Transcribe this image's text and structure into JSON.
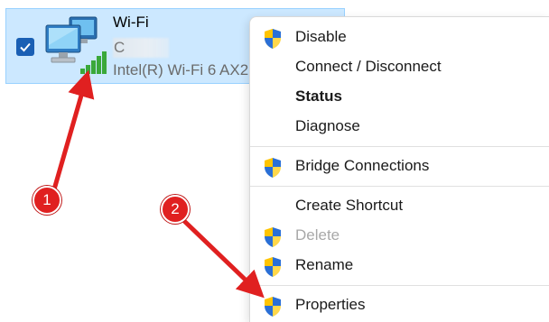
{
  "adapter": {
    "name": "Wi-Fi",
    "network": "C",
    "device": "Intel(R) Wi-Fi 6 AX2",
    "checked": true
  },
  "menu": {
    "items": [
      {
        "label": "Disable",
        "shield": true
      },
      {
        "label": "Connect / Disconnect",
        "shield": false
      },
      {
        "label": "Status",
        "shield": false,
        "bold": true
      },
      {
        "label": "Diagnose",
        "shield": false
      },
      {
        "label": "Bridge Connections",
        "shield": true
      },
      {
        "label": "Create Shortcut",
        "shield": false
      },
      {
        "label": "Delete",
        "shield": true,
        "disabled": true
      },
      {
        "label": "Rename",
        "shield": true
      },
      {
        "label": "Properties",
        "shield": true
      }
    ]
  },
  "annotations": {
    "badge1": "1",
    "badge2": "2",
    "color": "#e02020"
  },
  "colors": {
    "selection_bg": "#cce8ff",
    "selection_border": "#99d1ff",
    "checkbox": "#1a5fb4"
  }
}
